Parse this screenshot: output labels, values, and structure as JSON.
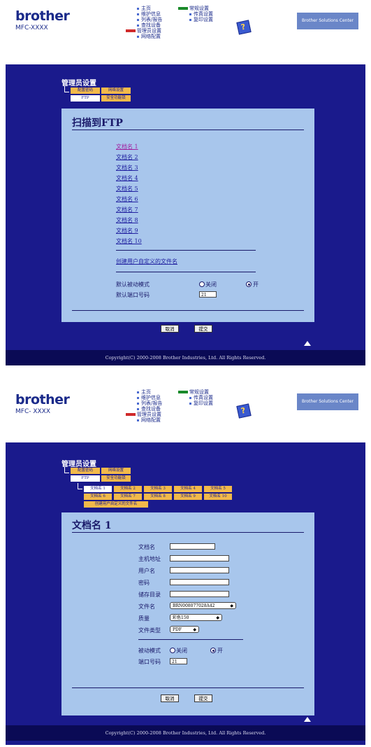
{
  "header": {
    "logo": "brother",
    "model": "MFC-XXXX",
    "model_spaced": "MFC- XXXX",
    "nav_left": [
      "主页",
      "维护信息",
      "列表/报告",
      "查找设备",
      "管理员设置",
      "网络配置"
    ],
    "nav_right": [
      "常规设置",
      "传真设置",
      "复印设置"
    ],
    "bsc_label": "Brother Solutions Center"
  },
  "shot1": {
    "section_title": "管理员设置",
    "tabs_row1": [
      "配置密码",
      "网络设置"
    ],
    "tabs_row2": [
      "FTP",
      "安全功能锁"
    ],
    "panel_title": "扫描到FTP",
    "files": [
      "文档名 1",
      "文档名 2",
      "文档名 3",
      "文档名 4",
      "文档名 5",
      "文档名 6",
      "文档名 7",
      "文档名 8",
      "文档名 9",
      "文档名 10"
    ],
    "create_link": "创建用户自定义的文件名",
    "passive_label": "默认被动模式",
    "off_label": "关闭",
    "on_label": "开",
    "port_label": "默认端口号码",
    "port_value": "21",
    "cancel": "取消",
    "submit": "提交",
    "copyright": "Copyright(C) 2000-2008 Brother Industries, Ltd. All Rights Reserved."
  },
  "shot2": {
    "section_title": "管理员设置",
    "tabs_row1": [
      "配置密码",
      "网络设置"
    ],
    "tabs_row2": [
      "FTP",
      "安全功能锁"
    ],
    "file_tabs_row1": [
      "文档名 1",
      "文档名 2",
      "文档名 3",
      "文档名 4",
      "文档名 5"
    ],
    "file_tabs_row2": [
      "文档名 6",
      "文档名 7",
      "文档名 8",
      "文档名 9",
      "文档名 10"
    ],
    "file_tabs_row3": [
      "创建用户自定义的文件名"
    ],
    "panel_title": "文档名 1",
    "fields": [
      "文档名",
      "主机地址",
      "用户名",
      "密码",
      "储存目录"
    ],
    "filename_label": "文件名",
    "filename_value": "BRN008077028A42",
    "quality_label": "质量",
    "quality_value": "彩色150",
    "filetype_label": "文件类型",
    "filetype_value": "PDF",
    "passive_label": "被动模式",
    "off_label": "关闭",
    "on_label": "开",
    "port_label": "端口号码",
    "port_value": "21",
    "cancel": "取消",
    "submit": "提交",
    "copyright": "Copyright(C) 2000-2008 Brother Industries, Ltd. All Rights Reserved."
  }
}
